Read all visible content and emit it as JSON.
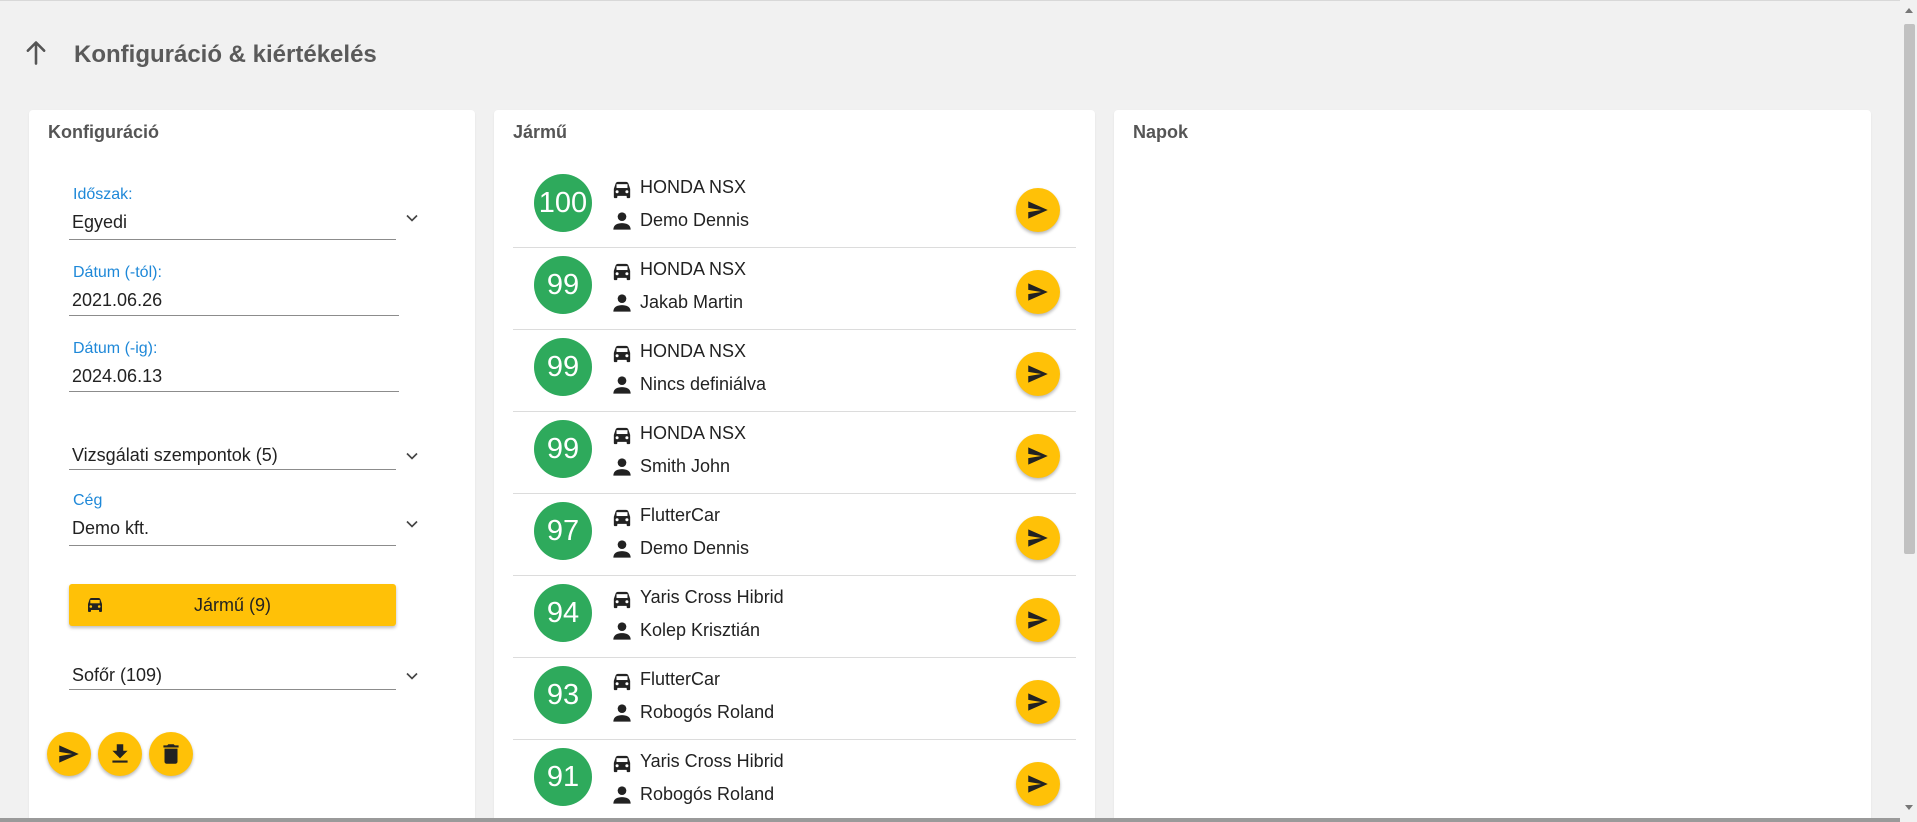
{
  "header": {
    "title": "Konfiguráció & kiértékelés",
    "back_icon": "arrow-up-icon"
  },
  "config": {
    "title": "Konfiguráció",
    "period": {
      "label": "Időszak:",
      "value": "Egyedi"
    },
    "date_from": {
      "label": "Dátum (-tól):",
      "value": "2021.06.26"
    },
    "date_to": {
      "label": "Dátum (-ig):",
      "value": "2024.06.13"
    },
    "criteria": {
      "value": "Vizsgálati szempontok (5)"
    },
    "company": {
      "label": "Cég",
      "value": "Demo kft."
    },
    "vehicle_button": {
      "label": "Jármű (9)",
      "icon": "car-icon"
    },
    "driver": {
      "value": "Sofőr (109)"
    },
    "actions": [
      {
        "name": "send-button",
        "icon": "send-icon"
      },
      {
        "name": "download-button",
        "icon": "download-icon"
      },
      {
        "name": "delete-button",
        "icon": "trash-icon"
      }
    ]
  },
  "vehicles": {
    "title": "Jármű",
    "items": [
      {
        "score": "100",
        "vehicle": "HONDA NSX",
        "driver": "Demo Dennis"
      },
      {
        "score": "99",
        "vehicle": "HONDA NSX",
        "driver": "Jakab Martin"
      },
      {
        "score": "99",
        "vehicle": "HONDA NSX",
        "driver": "Nincs definiálva"
      },
      {
        "score": "99",
        "vehicle": "HONDA NSX",
        "driver": "Smith John"
      },
      {
        "score": "97",
        "vehicle": "FlutterCar",
        "driver": "Demo Dennis"
      },
      {
        "score": "94",
        "vehicle": "Yaris Cross Hibrid",
        "driver": "Kolep Krisztián"
      },
      {
        "score": "93",
        "vehicle": "FlutterCar",
        "driver": "Robogós Roland"
      },
      {
        "score": "91",
        "vehicle": "Yaris Cross Hibrid",
        "driver": "Robogós Roland"
      }
    ]
  },
  "days": {
    "title": "Napok"
  },
  "colors": {
    "accent": "#ffc107",
    "score_green": "#2eaa5c",
    "label_blue": "#1e88d8"
  }
}
